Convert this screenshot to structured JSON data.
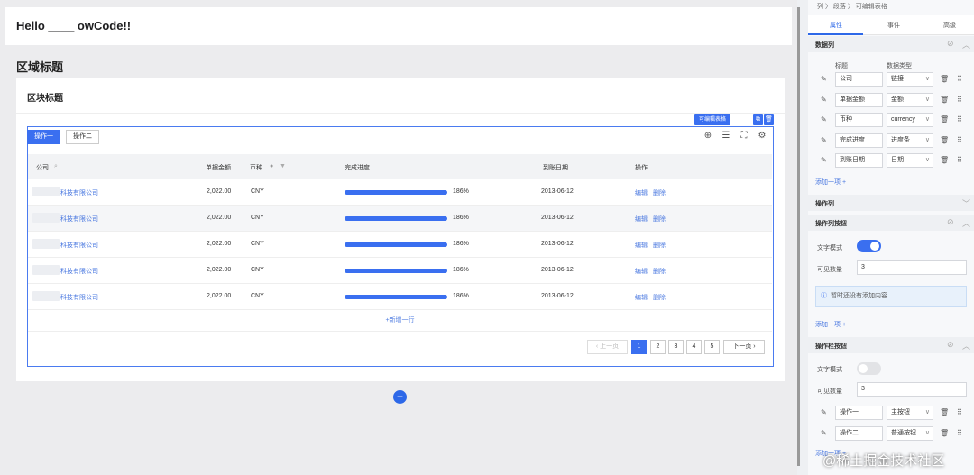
{
  "page": {
    "hello": "Hello ____ owCode!!",
    "region_title": "区域标题",
    "block_title": "区块标题"
  },
  "table": {
    "badge": "可编辑表格",
    "tabs": [
      "操作一",
      "操作二"
    ],
    "columns": {
      "company": "公司",
      "amount": "单据金额",
      "currency": "币种",
      "progress": "完成进度",
      "date": "到账日期",
      "action": "操作"
    },
    "rows": [
      {
        "company": "科技有限公司",
        "amount": "2,022.00",
        "currency": "CNY",
        "progress": 1,
        "progress_text": "186%",
        "date": "2013-06-12"
      },
      {
        "company": "科技有限公司",
        "amount": "2,022.00",
        "currency": "CNY",
        "progress": 1,
        "progress_text": "186%",
        "date": "2013-06-12"
      },
      {
        "company": "科技有限公司",
        "amount": "2,022.00",
        "currency": "CNY",
        "progress": 1,
        "progress_text": "186%",
        "date": "2013-06-12"
      },
      {
        "company": "科技有限公司",
        "amount": "2,022.00",
        "currency": "CNY",
        "progress": 1,
        "progress_text": "186%",
        "date": "2013-06-12"
      },
      {
        "company": "科技有限公司",
        "amount": "2,022.00",
        "currency": "CNY",
        "progress": 1,
        "progress_text": "186%",
        "date": "2013-06-12"
      }
    ],
    "row_actions": {
      "edit": "编辑",
      "delete": "删除"
    },
    "add_row": "+新增一行",
    "pagination": {
      "prev": "上一页",
      "pages": [
        "1",
        "2",
        "3",
        "4",
        "5"
      ],
      "current": "1",
      "next": "下一页"
    }
  },
  "panel": {
    "breadcrumb": "列  〉 段落  〉 可编辑表格",
    "tabs": [
      "属性",
      "事件",
      "高级"
    ],
    "data_columns": {
      "title": "数据列",
      "header_title": "标题",
      "header_type": "数据类型",
      "items": [
        {
          "title": "公司",
          "type": "链接"
        },
        {
          "title": "单据金额",
          "type": "金额"
        },
        {
          "title": "币种",
          "type": "currency"
        },
        {
          "title": "完成进度",
          "type": "进度条"
        },
        {
          "title": "到账日期",
          "type": "日期"
        }
      ],
      "add": "添加一项 +"
    },
    "action_column": {
      "title": "操作列"
    },
    "action_buttons": {
      "title": "操作列按钮",
      "text_mode_label": "文字模式",
      "visible_count_label": "可见数量",
      "visible_count": "3",
      "empty_info": "暂时还没有添加内容",
      "add": "添加一项 +"
    },
    "toolbar_buttons": {
      "title": "操作栏按钮",
      "text_mode_label": "文字模式",
      "visible_count_label": "可见数量",
      "visible_count": "3",
      "items": [
        {
          "title": "操作一",
          "type": "主按钮"
        },
        {
          "title": "操作二",
          "type": "普通按钮"
        }
      ],
      "add": "添加一项 +"
    }
  },
  "watermark": "@稀土掘金技术社区",
  "colors": {
    "accent": "#3a6ff0",
    "link": "#4a78e0"
  }
}
